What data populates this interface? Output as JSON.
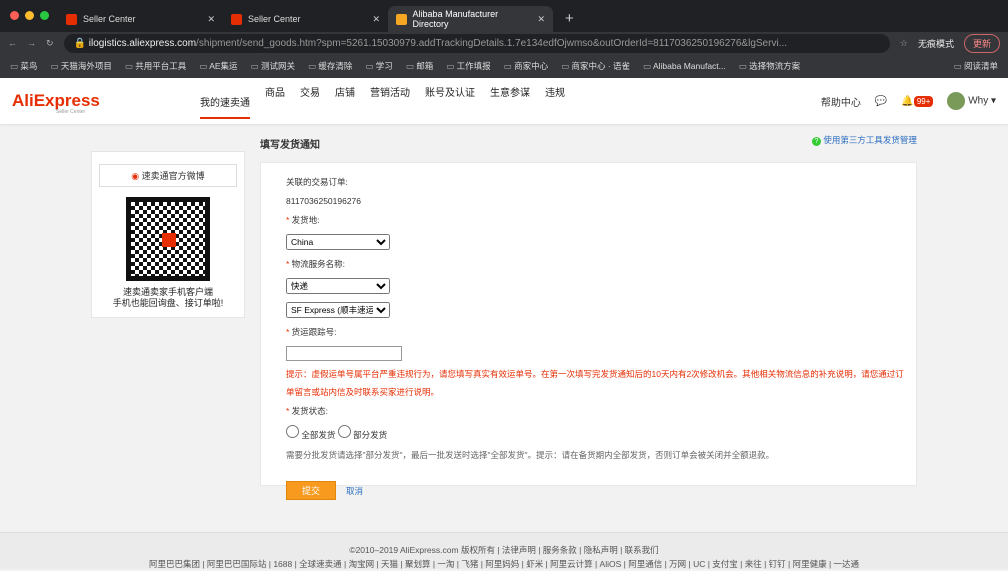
{
  "browser": {
    "tabs": [
      {
        "title": "Seller Center"
      },
      {
        "title": "Seller Center"
      },
      {
        "title": "Alibaba Manufacturer Directory"
      }
    ],
    "url_host": "ilogistics.aliexpress.com",
    "url_path": "/shipment/send_goods.htm?spm=5261.15030979.addTrackingDetails.1.7e134edfOjwmso&outOrderId=8117036250196276&lgServi...",
    "incognito": "无痕模式",
    "update": "更新",
    "bookmarks": [
      "菜鸟",
      "天猫海外项目",
      "共用平台工具",
      "AE集运",
      "测试网关",
      "缓存清除",
      "学习",
      "邮箱",
      "工作填报",
      "商家中心",
      "商家中心 · 语雀",
      "Alibaba Manufact...",
      "选择物流方案"
    ],
    "reading_list": "阅读清单"
  },
  "header": {
    "logo": "AliExpress",
    "logo_sub": "Seller Center",
    "nav": [
      "我的速卖通",
      "商品",
      "交易",
      "店铺",
      "营销活动",
      "账号及认证",
      "生意参谋",
      "违规"
    ],
    "help": "帮助中心",
    "badge": "99+",
    "user": "Why"
  },
  "left": {
    "weibo": "速卖通官方微博",
    "line1": "速卖通卖家手机客户端",
    "line2": "手机也能回询盘、接订单啦!"
  },
  "page": {
    "title": "填写发货通知",
    "third_party": "使用第三方工具发货管理"
  },
  "form": {
    "order_label": "关联的交易订单:",
    "order_id": "8117036250196276",
    "ship_from_label": "发货地:",
    "ship_from": "China",
    "logistics_label": "物流服务名称:",
    "service_type": "快递",
    "carrier": "SF Express (顺丰速运)",
    "tracking_label": "货运跟踪号:",
    "tracking_value": "",
    "warning": "提示：虚假运单号属平台严重违规行为，请您填写真实有效运单号。在第一次填写完发货通知后的10天内有2次修改机会。其他相关物流信息的补充说明，请您通过订单留言或站内信及时联系买家进行说明。",
    "status_label": "发货状态:",
    "status_full": "全部发货",
    "status_partial": "部分发货",
    "status_note": "需要分批发货请选择\"部分发货\"，最后一批发送时选择\"全部发货\"。提示：请在备货期内全部发货，否则订单会被关闭并全额退款。",
    "submit": "提交",
    "cancel": "取消"
  },
  "footer": {
    "line1": "©2010–2019 AliExpress.com 版权所有 | 法律声明 | 服务条款 | 隐私声明 | 联系我们",
    "line2": "阿里巴巴集团 | 阿里巴巴国际站 | 1688 | 全球速卖通 | 淘宝网 | 天猫 | 聚划算 | 一淘 | 飞猪 | 阿里妈妈 | 虾米 | 阿里云计算 | AliOS | 阿里通信 | 万网 | UC | 支付宝 | 来往 | 钉钉 | 阿里健康 | 一达通"
  }
}
